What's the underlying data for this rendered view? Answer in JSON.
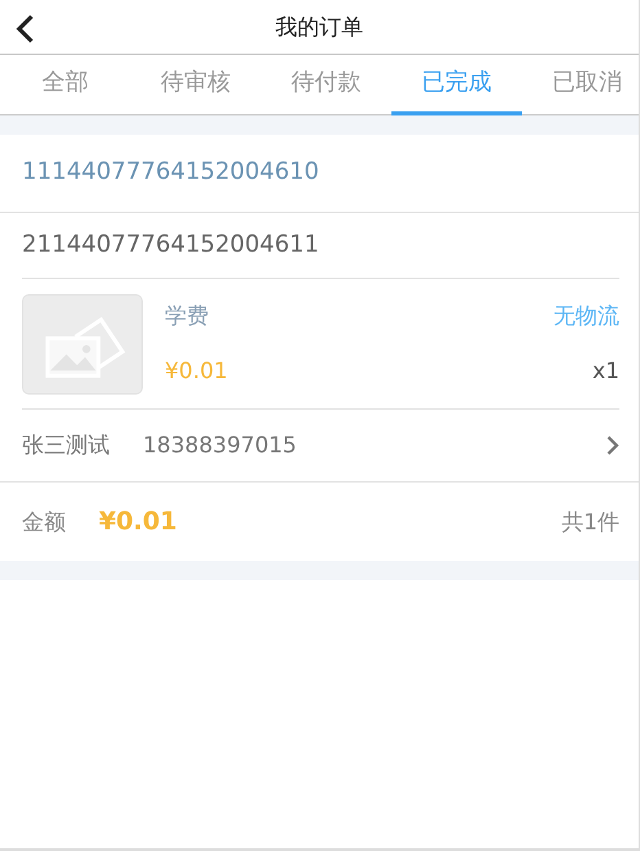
{
  "header": {
    "title": "我的订单"
  },
  "tabs": [
    {
      "label": "全部",
      "selected": false
    },
    {
      "label": "待审核",
      "selected": false
    },
    {
      "label": "待付款",
      "selected": false
    },
    {
      "label": "已完成",
      "selected": true
    },
    {
      "label": "已取消",
      "selected": false
    }
  ],
  "order": {
    "order_number": "11144077764152004610",
    "sub_order_number": "21144077764152004611",
    "item": {
      "name": "学费",
      "logistics": "无物流",
      "price": "¥0.01",
      "quantity": "x1"
    },
    "contact": {
      "name": "张三测试",
      "phone": "18388397015"
    },
    "total": {
      "label": "金额",
      "amount": "¥0.01",
      "count": "共1件"
    }
  }
}
